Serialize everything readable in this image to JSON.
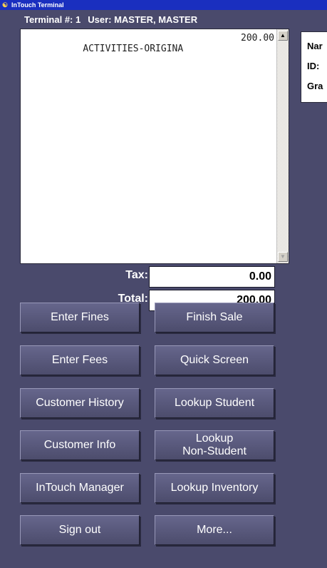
{
  "window": {
    "title": "InTouch Terminal",
    "icon": "app-icon"
  },
  "status": {
    "terminal": "Terminal #: 1",
    "user": "User: MASTER, MASTER"
  },
  "receipt": {
    "items": [
      {
        "description": "ACTIVITIES-ORIGINA",
        "amount": "200.00"
      }
    ]
  },
  "customer_panel": {
    "name_label": "Nar",
    "id_label": "ID:",
    "grade_label": "Gra"
  },
  "totals": {
    "tax_label": "Tax:",
    "tax_value": "0.00",
    "total_label": "Total:",
    "total_value": "200.00"
  },
  "buttons": {
    "enter_fines": "Enter Fines",
    "finish_sale": "Finish Sale",
    "enter_fees": "Enter Fees",
    "quick_screen": "Quick Screen",
    "customer_history": "Customer History",
    "lookup_student": "Lookup Student",
    "customer_info": "Customer Info",
    "lookup_non_student": "Lookup\nNon-Student",
    "intouch_manager": "InTouch Manager",
    "lookup_inventory": "Lookup Inventory",
    "sign_out": "Sign out",
    "more": "More..."
  },
  "colors": {
    "background": "#4a4a6c",
    "title_bar": "#1a2fbf",
    "button_face": "#5a5a7c"
  }
}
